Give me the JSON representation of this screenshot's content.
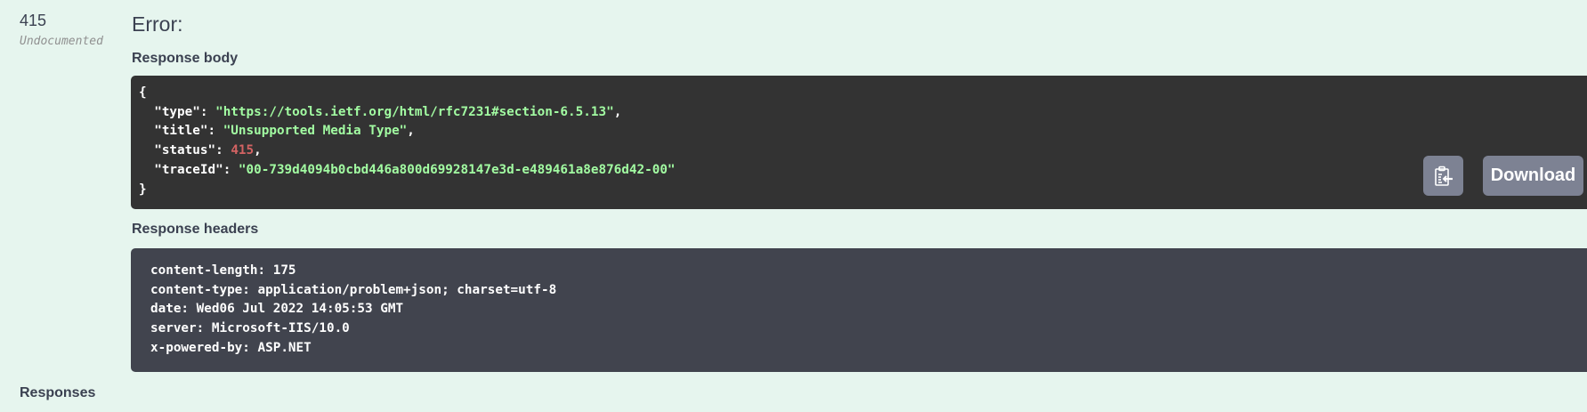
{
  "response": {
    "code": "415",
    "description": "Undocumented",
    "error_title": "Error:",
    "body_label": "Response body",
    "body": {
      "open": "{",
      "close": "}",
      "fields": [
        {
          "key": "\"type\"",
          "value": "\"https://tools.ietf.org/html/rfc7231#section-6.5.13\"",
          "kind": "string"
        },
        {
          "key": "\"title\"",
          "value": "\"Unsupported Media Type\"",
          "kind": "string"
        },
        {
          "key": "\"status\"",
          "value": "415",
          "kind": "number"
        },
        {
          "key": "\"traceId\"",
          "value": "\"00-739d4094b0cbd446a800d69928147e3d-e489461a8e876d42-00\"",
          "kind": "string"
        }
      ]
    },
    "copy_icon": "clipboard-copy-icon",
    "download_label": "Download",
    "headers_label": "Response headers",
    "headers": [
      "content-length: 175",
      "content-type: application/problem+json; charset=utf-8",
      "date: Wed06 Jul 2022 14:05:53 GMT",
      "server: Microsoft-IIS/10.0",
      "x-powered-by: ASP.NET"
    ]
  },
  "footer": {
    "responses_label": "Responses"
  },
  "colors": {
    "string": "#a2fca2",
    "number": "#d36363",
    "body_bg": "#333333",
    "headers_bg": "#41444e",
    "button": "#7d8293"
  }
}
